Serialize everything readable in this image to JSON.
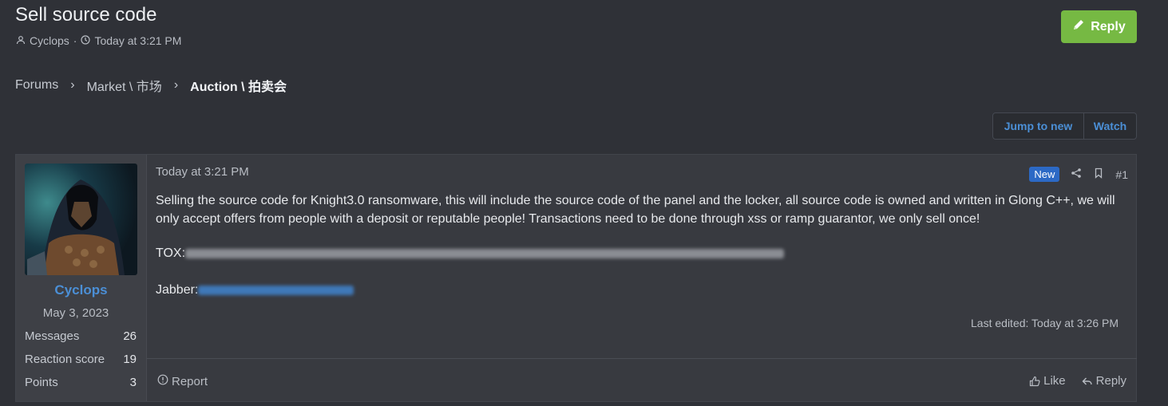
{
  "thread": {
    "title": "Sell source code",
    "author": "Cyclops",
    "separator": "·",
    "posted": "Today at 3:21 PM",
    "reply_label": "Reply"
  },
  "breadcrumb": {
    "items": [
      "Forums",
      "Market \\ 市场",
      "Auction \\ 拍卖会"
    ],
    "separator": "›"
  },
  "thread_actions": {
    "jump_label": "Jump to new",
    "watch_label": "Watch"
  },
  "post": {
    "user": {
      "name": "Cyclops",
      "joined": "May 3, 2023",
      "stats": [
        {
          "label": "Messages",
          "value": "26"
        },
        {
          "label": "Reaction score",
          "value": "19"
        },
        {
          "label": "Points",
          "value": "3"
        }
      ]
    },
    "date": "Today at 3:21 PM",
    "badge": "New",
    "number": "#1",
    "body": "Selling the source code for Knight3.0 ransomware, this will include the source code of the panel and the locker, all source code is owned and written in Glong C++, we will only accept offers from people with a deposit or reputable people! Transactions need to be done through xss or ramp guarantor, we only sell once!",
    "tox_label": "TOX:",
    "jabber_label": "Jabber:",
    "edited": "Last edited: Today at 3:26 PM",
    "report_label": "Report",
    "like_label": "Like",
    "reply_label": "Reply"
  },
  "colors": {
    "background": "#2f3137",
    "accent_blue": "#4b8fd6",
    "reply_green": "#76b943",
    "badge_blue": "#2c69c5"
  }
}
